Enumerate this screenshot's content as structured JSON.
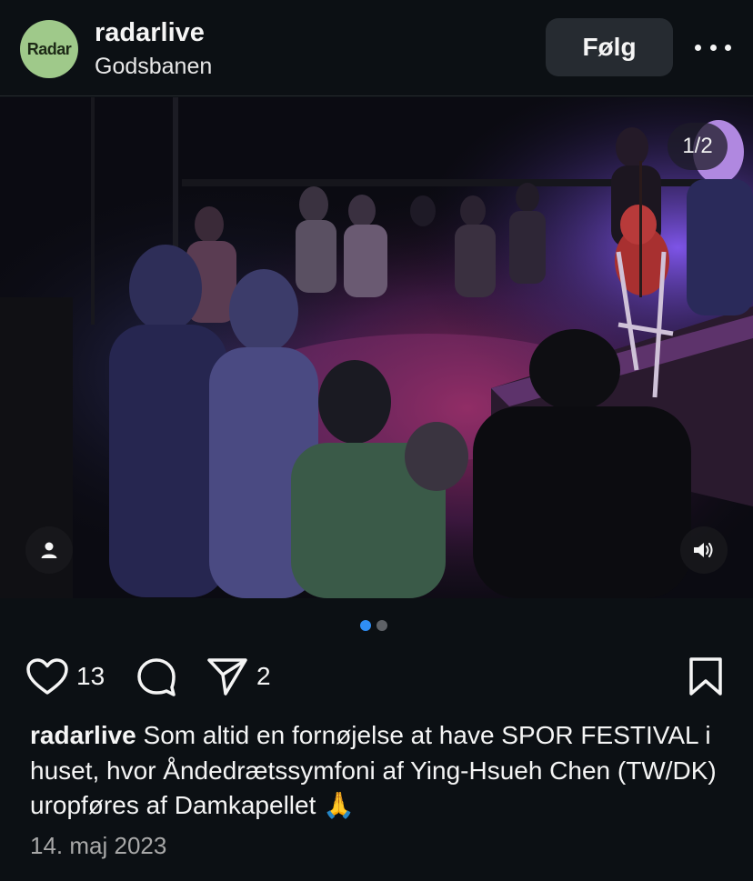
{
  "header": {
    "avatar_text": "Radar",
    "username": "radarlive",
    "location": "Godsbanen",
    "follow_label": "Følg",
    "more_icon": "more-horizontal-icon"
  },
  "media": {
    "counter": "1/2",
    "current_slide": 1,
    "total_slides": 2,
    "user_tag_icon": "user-icon",
    "sound_icon": "speaker-icon"
  },
  "actions": {
    "likes": "13",
    "shares": "2"
  },
  "caption": {
    "username": "radarlive",
    "text": "Som altid en fornøjelse at have SPOR FESTIVAL i huset, hvor Åndedrætssymfoni af Ying-Hsueh Chen (TW/DK) uropføres af Damkapellet 🙏"
  },
  "date": "14. maj 2023",
  "colors": {
    "background": "#0c1014",
    "accent_dot": "#2f8ef5",
    "avatar_bg": "#9fc98a"
  }
}
